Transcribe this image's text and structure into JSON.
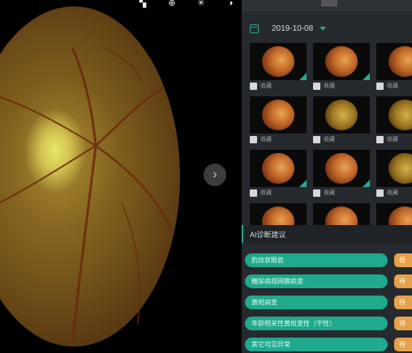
{
  "toolbar": {
    "items": [
      {
        "icon": "layout-grid-icon",
        "glyph": "▚"
      },
      {
        "icon": "zoom-icon",
        "glyph": "⊕"
      },
      {
        "icon": "brightness-icon",
        "glyph": "✳"
      },
      {
        "icon": "contrast-icon",
        "glyph": "◑"
      }
    ]
  },
  "viewer": {
    "next_glyph": "›"
  },
  "panel": {
    "date": "2019-10-08",
    "accent": "#2aa88d",
    "thumbnails": [
      {
        "fav_label": "收藏",
        "tone": "orange"
      },
      {
        "fav_label": "收藏",
        "tone": "orange"
      },
      {
        "fav_label": "收藏",
        "tone": "orange"
      },
      {
        "fav_label": "收藏",
        "tone": "orange"
      },
      {
        "fav_label": "收藏",
        "tone": "green"
      },
      {
        "fav_label": "收藏",
        "tone": "green"
      },
      {
        "fav_label": "收藏",
        "tone": "orange"
      },
      {
        "fav_label": "收藏",
        "tone": "orange"
      },
      {
        "fav_label": "收藏",
        "tone": "green"
      },
      {
        "fav_label": "",
        "tone": "orange"
      },
      {
        "fav_label": "",
        "tone": "orange"
      },
      {
        "fav_label": "",
        "tone": "orange"
      }
    ]
  },
  "ai": {
    "header": "AI诊断建议",
    "items": [
      {
        "label": "豹纹状眼底",
        "badge": "低"
      },
      {
        "label": "糖尿病视网膜病变",
        "badge": "待"
      },
      {
        "label": "黄斑病变",
        "badge": "待"
      },
      {
        "label": "年龄相关性黄斑变性（干性）",
        "badge": "待"
      },
      {
        "label": "其它可见异常",
        "badge": "待"
      }
    ]
  }
}
